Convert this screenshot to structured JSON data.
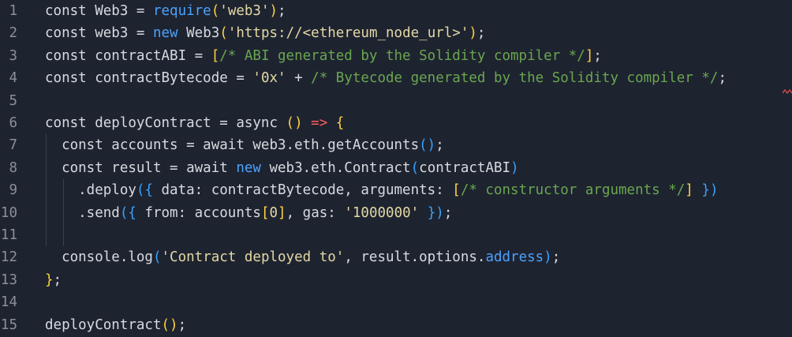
{
  "editor": {
    "line_numbers": [
      "1",
      "2",
      "3",
      "4",
      "5",
      "6",
      "7",
      "8",
      "9",
      "10",
      "11",
      "12",
      "13",
      "14",
      "15"
    ],
    "lines": [
      [
        {
          "t": "const Web3 = ",
          "c": "plain"
        },
        {
          "t": "require",
          "c": "fn-blue"
        },
        {
          "t": "(",
          "c": "br-yellow"
        },
        {
          "t": "'web3'",
          "c": "str"
        },
        {
          "t": ")",
          "c": "br-yellow"
        },
        {
          "t": ";",
          "c": "plain"
        }
      ],
      [
        {
          "t": "const web3 = ",
          "c": "plain"
        },
        {
          "t": "new ",
          "c": "fn-blue"
        },
        {
          "t": "Web3",
          "c": "plain"
        },
        {
          "t": "(",
          "c": "br-yellow"
        },
        {
          "t": "'https://<ethereum_node_url>'",
          "c": "str"
        },
        {
          "t": ")",
          "c": "br-yellow"
        },
        {
          "t": ";",
          "c": "plain"
        }
      ],
      [
        {
          "t": "const contractABI = ",
          "c": "plain"
        },
        {
          "t": "[",
          "c": "br-yellow"
        },
        {
          "t": "/* ABI generated by the Solidity compiler */",
          "c": "com"
        },
        {
          "t": "]",
          "c": "br-yellow"
        },
        {
          "t": ";",
          "c": "plain"
        }
      ],
      [
        {
          "t": "const contractBytecode = ",
          "c": "plain"
        },
        {
          "t": "'0x'",
          "c": "str"
        },
        {
          "t": " + ",
          "c": "plain"
        },
        {
          "t": "/* Bytecode generated by the Solidity compiler */",
          "c": "com"
        },
        {
          "t": ";",
          "c": "plain"
        }
      ],
      [],
      [
        {
          "t": "const deployContract = async ",
          "c": "plain"
        },
        {
          "t": "()",
          "c": "br-yellow"
        },
        {
          "t": " ",
          "c": "plain"
        },
        {
          "t": "=>",
          "c": "br-red"
        },
        {
          "t": " ",
          "c": "plain"
        },
        {
          "t": "{",
          "c": "br-yellow"
        }
      ],
      [
        {
          "t": "  const accounts = await web3.eth.getAccounts",
          "c": "plain"
        },
        {
          "t": "()",
          "c": "br-blue"
        },
        {
          "t": ";",
          "c": "plain"
        }
      ],
      [
        {
          "t": "  const result = await ",
          "c": "plain"
        },
        {
          "t": "new ",
          "c": "fn-blue"
        },
        {
          "t": "web3.eth.Contract",
          "c": "plain"
        },
        {
          "t": "(",
          "c": "br-blue"
        },
        {
          "t": "contractABI",
          "c": "plain"
        },
        {
          "t": ")",
          "c": "br-blue"
        }
      ],
      [
        {
          "t": "    .deploy",
          "c": "plain"
        },
        {
          "t": "({",
          "c": "br-blue"
        },
        {
          "t": " data: contractBytecode, arguments: ",
          "c": "plain"
        },
        {
          "t": "[",
          "c": "br-yellow"
        },
        {
          "t": "/* constructor arguments */",
          "c": "com"
        },
        {
          "t": "]",
          "c": "br-yellow"
        },
        {
          "t": " ",
          "c": "plain"
        },
        {
          "t": "})",
          "c": "br-blue"
        }
      ],
      [
        {
          "t": "    .send",
          "c": "plain"
        },
        {
          "t": "({",
          "c": "br-blue"
        },
        {
          "t": " from: accounts",
          "c": "plain"
        },
        {
          "t": "[",
          "c": "br-yellow"
        },
        {
          "t": "0",
          "c": "num"
        },
        {
          "t": "]",
          "c": "br-yellow"
        },
        {
          "t": ", gas: ",
          "c": "plain"
        },
        {
          "t": "'1000000'",
          "c": "str"
        },
        {
          "t": " ",
          "c": "plain"
        },
        {
          "t": "})",
          "c": "br-blue"
        },
        {
          "t": ";",
          "c": "plain"
        }
      ],
      [],
      [
        {
          "t": "  console.log",
          "c": "plain"
        },
        {
          "t": "(",
          "c": "br-blue"
        },
        {
          "t": "'Contract deployed to'",
          "c": "str"
        },
        {
          "t": ", result.options.",
          "c": "plain"
        },
        {
          "t": "address",
          "c": "fn-blue"
        },
        {
          "t": ")",
          "c": "br-blue"
        },
        {
          "t": ";",
          "c": "plain"
        }
      ],
      [
        {
          "t": "}",
          "c": "br-yellow"
        },
        {
          "t": ";",
          "c": "plain"
        }
      ],
      [],
      [
        {
          "t": "deployContract",
          "c": "plain"
        },
        {
          "t": "()",
          "c": "br-yellow"
        },
        {
          "t": ";",
          "c": "plain"
        }
      ]
    ]
  },
  "colors": {
    "background": "#1e2330",
    "text": "#d7dbe0",
    "keyword_blue": "#4aa3ff",
    "string": "#e3d9a4",
    "comment": "#6aa64f",
    "bracket_yellow": "#ffd23f",
    "bracket_blue": "#36a3ff",
    "arrow_red": "#ff5d5d"
  }
}
